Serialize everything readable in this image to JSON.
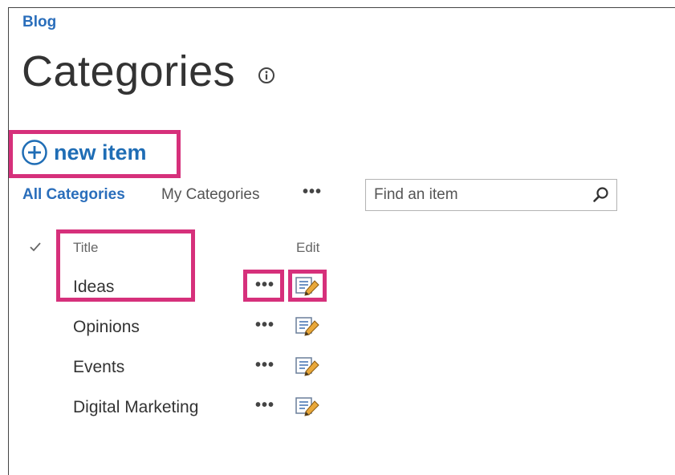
{
  "breadcrumb": {
    "label": "Blog"
  },
  "page": {
    "title": "Categories"
  },
  "actions": {
    "new_item_label": "new item"
  },
  "views": {
    "all_label": "All Categories",
    "mine_label": "My Categories",
    "more_label": "•••"
  },
  "search": {
    "placeholder": "Find an item",
    "value": ""
  },
  "table": {
    "columns": {
      "title": "Title",
      "edit": "Edit"
    },
    "rows": [
      {
        "title": "Ideas",
        "more": "•••"
      },
      {
        "title": "Opinions",
        "more": "•••"
      },
      {
        "title": "Events",
        "more": "•••"
      },
      {
        "title": "Digital Marketing",
        "more": "•••"
      }
    ]
  },
  "icons": {
    "info": "info-icon",
    "add": "plus-circle-icon",
    "search": "magnifier-icon",
    "select_all": "checkmark-icon",
    "edit": "edit-pencil-icon"
  },
  "colors": {
    "link": "#2a6ebb",
    "new_item": "#1f6db5",
    "highlight": "#d6307b",
    "text": "#333333"
  }
}
